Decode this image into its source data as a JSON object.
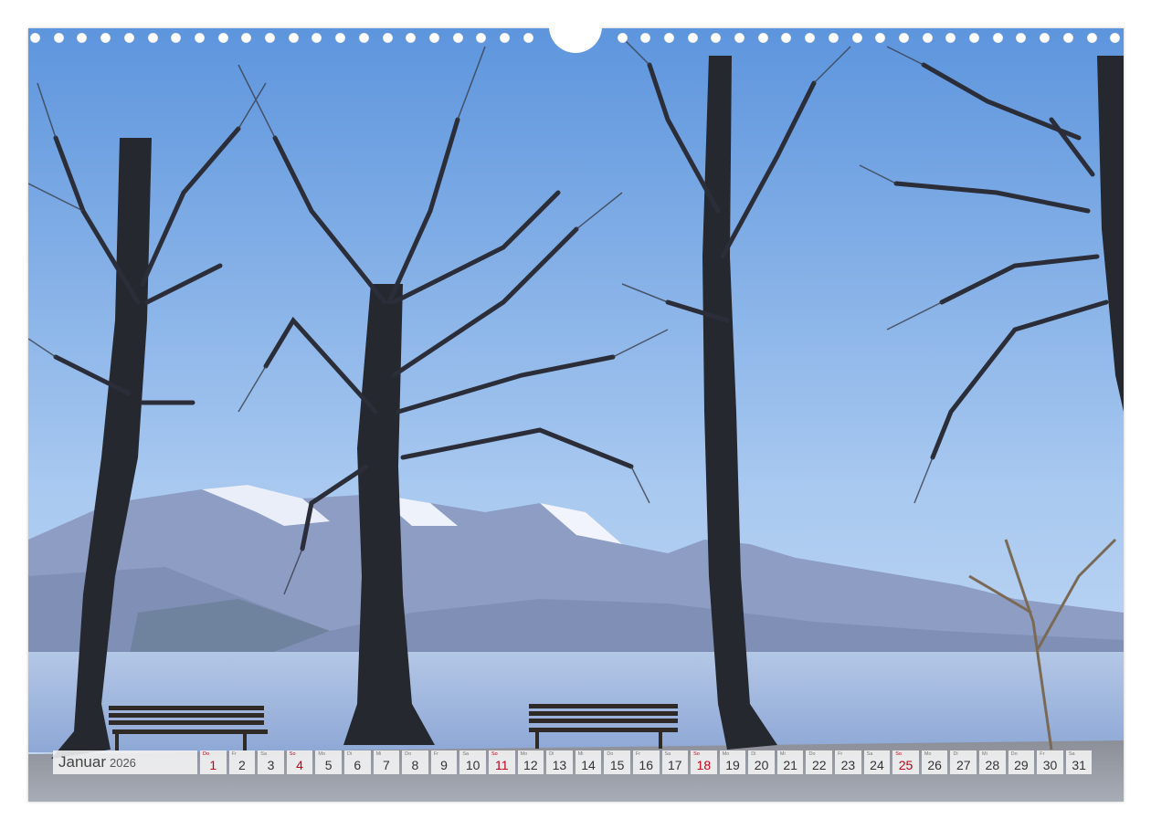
{
  "calendar": {
    "month": "Januar",
    "year": "2026",
    "days": [
      {
        "wd": "Do",
        "n": "1",
        "sun": true
      },
      {
        "wd": "Fr",
        "n": "2",
        "sun": false
      },
      {
        "wd": "Sa",
        "n": "3",
        "sun": false
      },
      {
        "wd": "So",
        "n": "4",
        "sun": true
      },
      {
        "wd": "Mo",
        "n": "5",
        "sun": false
      },
      {
        "wd": "Di",
        "n": "6",
        "sun": false
      },
      {
        "wd": "Mi",
        "n": "7",
        "sun": false
      },
      {
        "wd": "Do",
        "n": "8",
        "sun": false
      },
      {
        "wd": "Fr",
        "n": "9",
        "sun": false
      },
      {
        "wd": "Sa",
        "n": "10",
        "sun": false
      },
      {
        "wd": "So",
        "n": "11",
        "sun": true
      },
      {
        "wd": "Mo",
        "n": "12",
        "sun": false
      },
      {
        "wd": "Di",
        "n": "13",
        "sun": false
      },
      {
        "wd": "Mi",
        "n": "14",
        "sun": false
      },
      {
        "wd": "Do",
        "n": "15",
        "sun": false
      },
      {
        "wd": "Fr",
        "n": "16",
        "sun": false
      },
      {
        "wd": "Sa",
        "n": "17",
        "sun": false
      },
      {
        "wd": "So",
        "n": "18",
        "sun": true
      },
      {
        "wd": "Mo",
        "n": "19",
        "sun": false
      },
      {
        "wd": "Di",
        "n": "20",
        "sun": false
      },
      {
        "wd": "Mi",
        "n": "21",
        "sun": false
      },
      {
        "wd": "Do",
        "n": "22",
        "sun": false
      },
      {
        "wd": "Fr",
        "n": "23",
        "sun": false
      },
      {
        "wd": "Sa",
        "n": "24",
        "sun": false
      },
      {
        "wd": "So",
        "n": "25",
        "sun": true
      },
      {
        "wd": "Mo",
        "n": "26",
        "sun": false
      },
      {
        "wd": "Di",
        "n": "27",
        "sun": false
      },
      {
        "wd": "Mi",
        "n": "28",
        "sun": false
      },
      {
        "wd": "Do",
        "n": "29",
        "sun": false
      },
      {
        "wd": "Fr",
        "n": "30",
        "sun": false
      },
      {
        "wd": "Sa",
        "n": "31",
        "sun": false
      }
    ]
  },
  "colors": {
    "sky_top": "#6a9fe0",
    "sky_bottom": "#bcd6f3",
    "mountain": "#8d9cc0",
    "snow": "#eef2fb",
    "lake": "#9fb7de",
    "ground": "#9aa2ae",
    "tree": "#23252d",
    "sunday": "#c0001a"
  },
  "icons": {
    "binding": "spiral-binding-holes",
    "hanger": "calendar-hanger-cutout"
  }
}
